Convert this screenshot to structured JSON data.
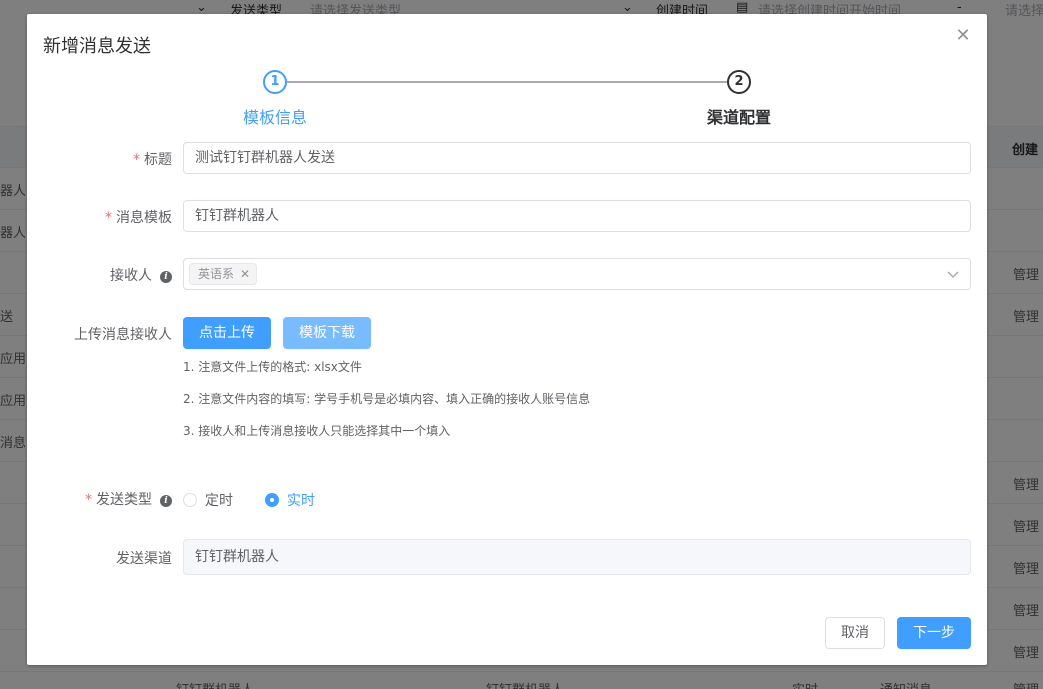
{
  "background": {
    "filter": {
      "send_type_label": "发送类型",
      "send_type_placeholder": "请选择发送类型",
      "create_time_label": "创建时间",
      "create_time_placeholder": "请选择创建时间开始时间",
      "range_sep": "-",
      "end_placeholder": "请选择"
    },
    "table": {
      "header_last": "创建",
      "rows": [
        {
          "c1": "器人",
          "c2": ""
        },
        {
          "c1": "器人",
          "c2": ""
        },
        {
          "c1": "",
          "c2": "管理"
        },
        {
          "c1": "送",
          "c2": "管理"
        },
        {
          "c1": "应用消",
          "c2": ""
        },
        {
          "c1": "应用消",
          "c2": ""
        },
        {
          "c1": "消息",
          "c2": ""
        },
        {
          "c1": "",
          "c2": "管理"
        },
        {
          "c1": "",
          "c2": "管理"
        },
        {
          "c1": "",
          "c2": "管理"
        },
        {
          "c1": "",
          "c2": "管理"
        },
        {
          "c1": "",
          "c2": "管理"
        }
      ],
      "bottom": [
        "钉钉群机器人",
        "钉钉群机器人",
        "实时",
        "通知消息",
        "管理"
      ]
    }
  },
  "dialog": {
    "title": "新增消息发送",
    "steps": [
      {
        "number": "1",
        "title": "模板信息",
        "status": "active"
      },
      {
        "number": "2",
        "title": "渠道配置",
        "status": "wait"
      }
    ],
    "form": {
      "title_label": "标题",
      "title_value": "测试钉钉群机器人发送",
      "template_label": "消息模板",
      "template_value": "钉钉群机器人",
      "receiver_label": "接收人",
      "receiver_tags": [
        "英语系"
      ],
      "upload_label": "上传消息接收人",
      "upload_button": "点击上传",
      "download_button": "模板下载",
      "tips": [
        "1. 注意文件上传的格式: xlsx文件",
        "2. 注意文件内容的填写: 学号手机号是必填内容、填入正确的接收人账号信息",
        "3. 接收人和上传消息接收人只能选择其中一个填入"
      ],
      "send_type_label": "发送类型",
      "send_type_options": [
        "定时",
        "实时"
      ],
      "send_type_selected": "实时",
      "channel_label": "发送渠道",
      "channel_value": "钉钉群机器人"
    },
    "footer": {
      "cancel": "取消",
      "next": "下一步"
    }
  },
  "colors": {
    "primary": "#409eff",
    "primary_light": "#79bbff",
    "required": "#f56c6c",
    "text": "#606266"
  }
}
